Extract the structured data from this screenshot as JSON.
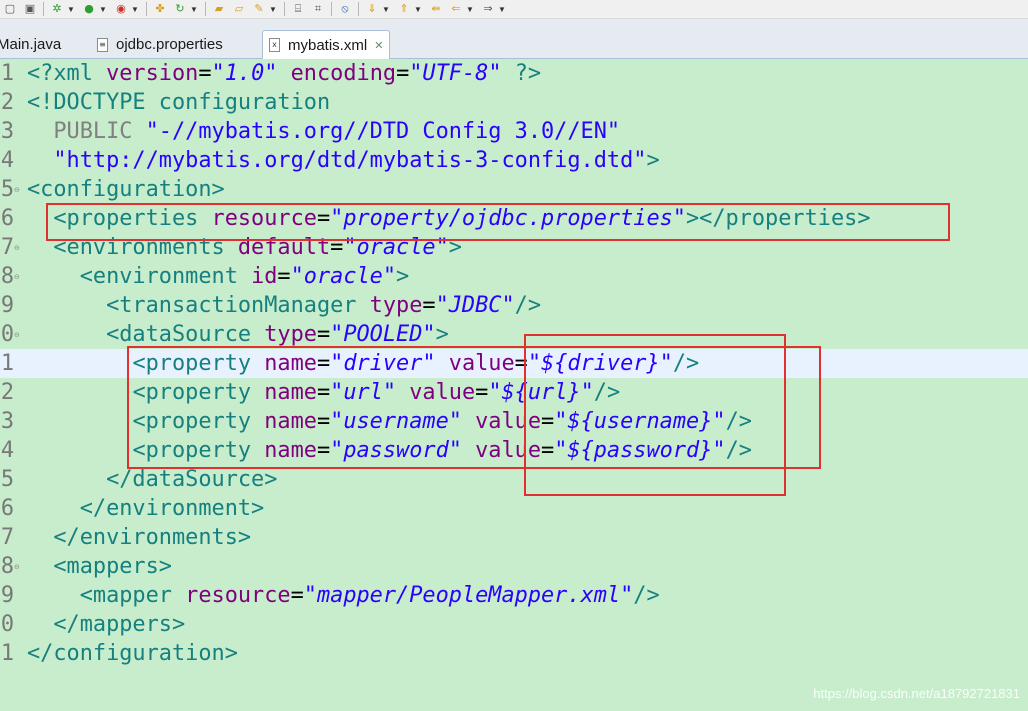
{
  "toolbar": {
    "buttons": [
      "new-file-icon",
      "save-icon",
      "debug-icon",
      "run-icon",
      "run-external-icon",
      "new-package-icon",
      "refresh-icon",
      "open-folder-icon",
      "open-file-icon",
      "search-icon",
      "build-icon",
      "pin-icon",
      "next-annotation-icon",
      "previous-annotation-icon",
      "back-icon",
      "forward-icon"
    ]
  },
  "tabs": [
    {
      "label": "Main.java",
      "active": false
    },
    {
      "label": "ojdbc.properties",
      "active": false
    },
    {
      "label": "mybatis.xml",
      "active": true
    }
  ],
  "editor": {
    "current_line": 11,
    "lines": [
      {
        "number": "1",
        "fold": "",
        "tokens": [
          {
            "t": "tag",
            "v": "<?xml "
          },
          {
            "t": "attr",
            "v": "version"
          },
          {
            "t": "text",
            "v": "="
          },
          {
            "t": "val",
            "v": "\"1.0\""
          },
          {
            "t": "text",
            "v": " "
          },
          {
            "t": "attr",
            "v": "encoding"
          },
          {
            "t": "text",
            "v": "="
          },
          {
            "t": "val",
            "v": "\"UTF-8\""
          },
          {
            "t": "tag",
            "v": " ?>"
          }
        ]
      },
      {
        "number": "2",
        "fold": "",
        "tokens": [
          {
            "t": "tag",
            "v": "<!DOCTYPE configuration"
          }
        ]
      },
      {
        "number": "3",
        "fold": "",
        "tokens": [
          {
            "t": "text",
            "v": "  "
          },
          {
            "t": "pub",
            "v": "PUBLIC"
          },
          {
            "t": "text",
            "v": " "
          },
          {
            "t": "str",
            "v": "\"-//mybatis.org//DTD Config 3.0//EN\""
          }
        ]
      },
      {
        "number": "4",
        "fold": "",
        "tokens": [
          {
            "t": "text",
            "v": "  "
          },
          {
            "t": "str",
            "v": "\"http://mybatis.org/dtd/mybatis-3-config.dtd\""
          },
          {
            "t": "tag",
            "v": ">"
          }
        ]
      },
      {
        "number": "5",
        "fold": "⊖",
        "tokens": [
          {
            "t": "tag",
            "v": "<configuration>"
          }
        ]
      },
      {
        "number": "6",
        "fold": "",
        "tokens": [
          {
            "t": "text",
            "v": "  "
          },
          {
            "t": "tag",
            "v": "<properties "
          },
          {
            "t": "attr",
            "v": "resource"
          },
          {
            "t": "text",
            "v": "="
          },
          {
            "t": "val",
            "v": "\"property/ojdbc.properties\""
          },
          {
            "t": "tag",
            "v": "></properties>"
          }
        ]
      },
      {
        "number": "7",
        "fold": "⊖",
        "tokens": [
          {
            "t": "text",
            "v": "  "
          },
          {
            "t": "tag",
            "v": "<environments "
          },
          {
            "t": "attr",
            "v": "default"
          },
          {
            "t": "text",
            "v": "="
          },
          {
            "t": "val",
            "v": "\"oracle\""
          },
          {
            "t": "tag",
            "v": ">"
          }
        ]
      },
      {
        "number": "8",
        "fold": "⊖",
        "tokens": [
          {
            "t": "text",
            "v": "    "
          },
          {
            "t": "tag",
            "v": "<environment "
          },
          {
            "t": "attr",
            "v": "id"
          },
          {
            "t": "text",
            "v": "="
          },
          {
            "t": "val",
            "v": "\"oracle\""
          },
          {
            "t": "tag",
            "v": ">"
          }
        ]
      },
      {
        "number": "9",
        "fold": "",
        "tokens": [
          {
            "t": "text",
            "v": "      "
          },
          {
            "t": "tag",
            "v": "<transactionManager "
          },
          {
            "t": "attr",
            "v": "type"
          },
          {
            "t": "text",
            "v": "="
          },
          {
            "t": "val",
            "v": "\"JDBC\""
          },
          {
            "t": "tag",
            "v": "/>"
          }
        ]
      },
      {
        "number": "0",
        "fold": "⊖",
        "tokens": [
          {
            "t": "text",
            "v": "      "
          },
          {
            "t": "tag",
            "v": "<dataSource "
          },
          {
            "t": "attr",
            "v": "type"
          },
          {
            "t": "text",
            "v": "="
          },
          {
            "t": "val",
            "v": "\"POOLED\""
          },
          {
            "t": "tag",
            "v": ">"
          }
        ]
      },
      {
        "number": "1",
        "fold": "",
        "tokens": [
          {
            "t": "text",
            "v": "        "
          },
          {
            "t": "tag",
            "v": "<property "
          },
          {
            "t": "attr",
            "v": "name"
          },
          {
            "t": "text",
            "v": "="
          },
          {
            "t": "val",
            "v": "\"driver\""
          },
          {
            "t": "text",
            "v": " "
          },
          {
            "t": "attr",
            "v": "value"
          },
          {
            "t": "text",
            "v": "="
          },
          {
            "t": "val",
            "v": "\"${driver}\""
          },
          {
            "t": "tag",
            "v": "/>"
          }
        ]
      },
      {
        "number": "2",
        "fold": "",
        "tokens": [
          {
            "t": "text",
            "v": "        "
          },
          {
            "t": "tag",
            "v": "<property "
          },
          {
            "t": "attr",
            "v": "name"
          },
          {
            "t": "text",
            "v": "="
          },
          {
            "t": "val",
            "v": "\"url\""
          },
          {
            "t": "text",
            "v": " "
          },
          {
            "t": "attr",
            "v": "value"
          },
          {
            "t": "text",
            "v": "="
          },
          {
            "t": "val",
            "v": "\"${url}\""
          },
          {
            "t": "tag",
            "v": "/>"
          }
        ]
      },
      {
        "number": "3",
        "fold": "",
        "tokens": [
          {
            "t": "text",
            "v": "        "
          },
          {
            "t": "tag",
            "v": "<property "
          },
          {
            "t": "attr",
            "v": "name"
          },
          {
            "t": "text",
            "v": "="
          },
          {
            "t": "val",
            "v": "\"username\""
          },
          {
            "t": "text",
            "v": " "
          },
          {
            "t": "attr",
            "v": "value"
          },
          {
            "t": "text",
            "v": "="
          },
          {
            "t": "val",
            "v": "\"${username}\""
          },
          {
            "t": "tag",
            "v": "/>"
          }
        ]
      },
      {
        "number": "4",
        "fold": "",
        "tokens": [
          {
            "t": "text",
            "v": "        "
          },
          {
            "t": "tag",
            "v": "<property "
          },
          {
            "t": "attr",
            "v": "name"
          },
          {
            "t": "text",
            "v": "="
          },
          {
            "t": "val",
            "v": "\"password\""
          },
          {
            "t": "text",
            "v": " "
          },
          {
            "t": "attr",
            "v": "value"
          },
          {
            "t": "text",
            "v": "="
          },
          {
            "t": "val",
            "v": "\"${password}\""
          },
          {
            "t": "tag",
            "v": "/>"
          }
        ]
      },
      {
        "number": "5",
        "fold": "",
        "tokens": [
          {
            "t": "text",
            "v": "      "
          },
          {
            "t": "tag",
            "v": "</dataSource>"
          }
        ]
      },
      {
        "number": "6",
        "fold": "",
        "tokens": [
          {
            "t": "text",
            "v": "    "
          },
          {
            "t": "tag",
            "v": "</environment>"
          }
        ]
      },
      {
        "number": "7",
        "fold": "",
        "tokens": [
          {
            "t": "text",
            "v": "  "
          },
          {
            "t": "tag",
            "v": "</environments>"
          }
        ]
      },
      {
        "number": "8",
        "fold": "⊖",
        "tokens": [
          {
            "t": "text",
            "v": "  "
          },
          {
            "t": "tag",
            "v": "<mappers>"
          }
        ]
      },
      {
        "number": "9",
        "fold": "",
        "tokens": [
          {
            "t": "text",
            "v": "    "
          },
          {
            "t": "tag",
            "v": "<mapper "
          },
          {
            "t": "attr",
            "v": "resource"
          },
          {
            "t": "text",
            "v": "="
          },
          {
            "t": "val",
            "v": "\"mapper/PeopleMapper.xml\""
          },
          {
            "t": "tag",
            "v": "/>"
          }
        ]
      },
      {
        "number": "0",
        "fold": "",
        "tokens": [
          {
            "t": "text",
            "v": "  "
          },
          {
            "t": "tag",
            "v": "</mappers>"
          }
        ]
      },
      {
        "number": "1",
        "fold": "",
        "tokens": [
          {
            "t": "tag",
            "v": "</configuration>"
          }
        ]
      }
    ]
  },
  "colors": {
    "background": "#c7edcc",
    "tag": "#168080",
    "attribute": "#7f007f",
    "value": "#2a00ff",
    "highlight_box": "#e03030",
    "current_line": "#e8f2fe"
  },
  "watermark": "https://blog.csdn.net/a18792721831"
}
